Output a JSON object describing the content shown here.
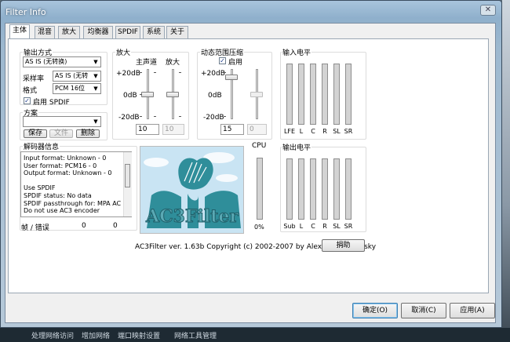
{
  "window": {
    "title": "Filter Info",
    "close_glyph": "✕"
  },
  "tabs": [
    "主体",
    "混音",
    "放大",
    "均衡器",
    "SPDIF",
    "系统",
    "关于"
  ],
  "output_mode": {
    "title": "输出方式",
    "format_value": "AS IS (无转换)",
    "sample_rate_label": "采样率",
    "sample_rate_value": "AS IS (无转",
    "format_label": "格式",
    "bit_format_value": "PCM 16位",
    "spdif_label": "启用 SPDIF",
    "spdif_checked": true
  },
  "preset": {
    "title": "方案",
    "value": "",
    "save": "保存",
    "file": "文件",
    "delete": "删除"
  },
  "gain": {
    "title": "放大",
    "master_label": "主声道",
    "gain_label": "放大",
    "scale": [
      "+20dB",
      "0dB",
      "-20dB"
    ],
    "master_value": "10",
    "gain_value": "10",
    "master_level": 0.5,
    "gain_level": 0.5
  },
  "drc": {
    "title": "动态范围压缩",
    "enable_label": "启用",
    "enabled": true,
    "scale": [
      "+20dB",
      "0dB",
      "-20dB"
    ],
    "value": "15",
    "value2": "0",
    "level": 0.13,
    "level2": 0.5
  },
  "input_levels": {
    "title": "输入电平",
    "channels": [
      "LFE",
      "L",
      "C",
      "R",
      "SL",
      "SR"
    ]
  },
  "output_levels": {
    "title": "输出电平",
    "channels": [
      "Sub",
      "L",
      "C",
      "R",
      "SL",
      "SR"
    ]
  },
  "cpu": {
    "title": "CPU",
    "value": "0%"
  },
  "decoder_info": {
    "title": "解码器信息",
    "lines": [
      "Input format: Unknown - 0",
      "User format: PCM16 - 0",
      "Output format: Unknown - 0",
      "",
      "Use SPDIF",
      "  SPDIF status: No data",
      "  SPDIF passthrough for: MPA AC",
      "  Do not use AC3 encoder"
    ]
  },
  "frames": {
    "label": "帧 / 错误",
    "frames": "0",
    "errors": "0"
  },
  "logo_text": "AC3Filter",
  "copyright": "AC3Filter ver. 1.63b Copyright (c) 2002-2007 by Alexander Vigovsky",
  "donate": "捐助",
  "buttons": {
    "ok": "确定(O)",
    "cancel": "取消(C)",
    "apply": "应用(A)"
  },
  "taskbar": [
    "处理网络访问",
    "增加网络",
    "端口映射设置",
    "网络工具管理"
  ],
  "colors": {
    "logo_teal": "#2f8e9a",
    "logo_sky": "#c9e4f3"
  }
}
